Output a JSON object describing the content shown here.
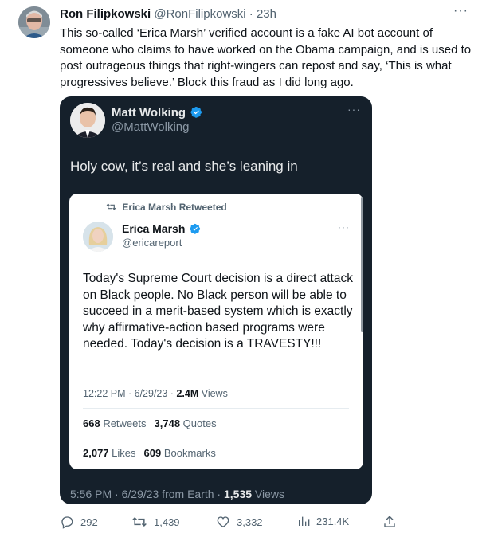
{
  "author": {
    "name": "Ron Filipkowski",
    "handle": "@RonFilipkowski",
    "separator": "·",
    "time": "23h"
  },
  "tweet_text": "This so-called ‘Erica Marsh’ verified account is a fake AI bot account of someone who claims to have worked on the Obama campaign, and is used to post outrageous things that right-wingers can repost and say, ‘This is what progressives believe.’ Block this fraud as I did long ago.",
  "more_label": "···",
  "embedded": {
    "name": "Matt Wolking",
    "handle": "@MattWolking",
    "text": "Holy cow, it’s real and she’s leaning in",
    "more_label": "···",
    "footer": {
      "time": "5:56 PM · 6/29/23 from Earth · ",
      "views_count": "1,535",
      "views_label": " Views"
    },
    "quoted": {
      "retweeted_label": "Erica Marsh Retweeted",
      "name": "Erica Marsh",
      "handle": "@ericareport",
      "more_label": "···",
      "text": "Today's Supreme Court decision is a direct attack on Black people. No Black person will be able to succeed in a merit-based system which is exactly why affirmative-action based programs were needed. Today's decision is a TRAVESTY!!!",
      "meta_time": "12:22 PM · 6/29/23 · ",
      "views_count": "2.4M",
      "views_label": " Views",
      "retweets_count": "668",
      "retweets_label": " Retweets",
      "quotes_count": "3,748",
      "quotes_label": " Quotes",
      "likes_count": "2,077",
      "likes_label": " Likes",
      "bookmarks_count": "609",
      "bookmarks_label": " Bookmarks"
    }
  },
  "actions": {
    "replies": "292",
    "retweets": "1,439",
    "likes": "3,332",
    "views": "231.4K"
  },
  "colors": {
    "verified": "#1d9bf0",
    "text_secondary": "#536471",
    "dark_card": "#15202b"
  }
}
